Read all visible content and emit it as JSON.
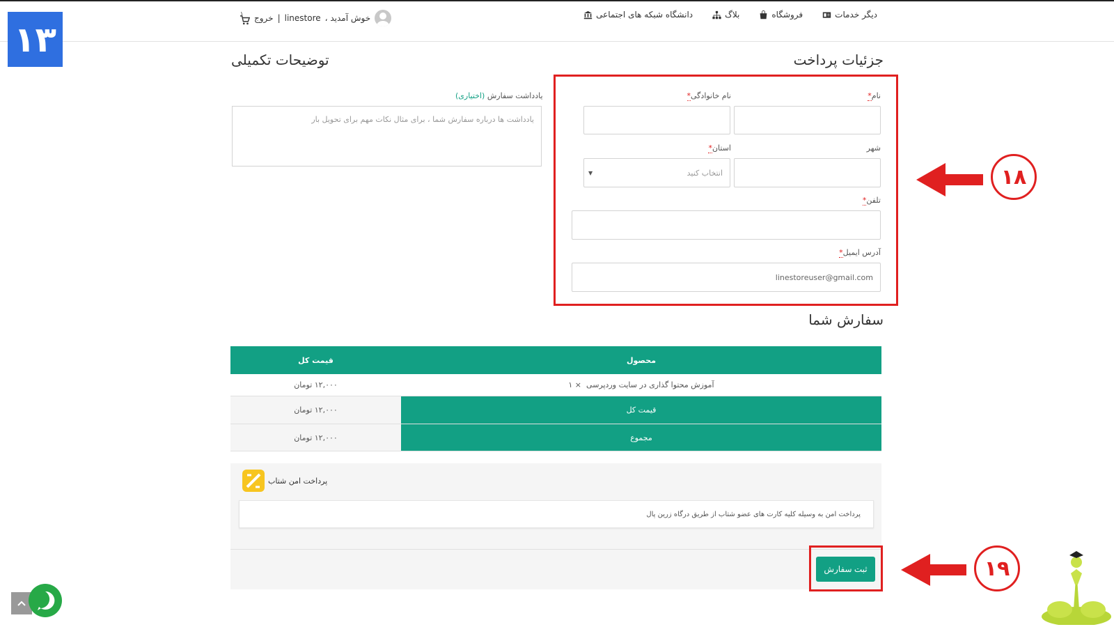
{
  "corner_badge": "۱۳",
  "nav": {
    "items": [
      {
        "label": "دانشگاه شبکه های اجتماعی",
        "icon": "bank-icon"
      },
      {
        "label": "بلاگ",
        "icon": "sitemap-icon"
      },
      {
        "label": "فروشگاه",
        "icon": "shopping-bag-icon"
      },
      {
        "label": "دیگر خدمات",
        "icon": "id-card-icon"
      }
    ]
  },
  "user": {
    "welcome": "خوش آمدید ،",
    "username": "linestore",
    "separator": "|",
    "logout": "خروج",
    "cart_count": "۱"
  },
  "billing": {
    "title": "جزئیات پرداخت",
    "first_name_label": "نام",
    "last_name_label": "نام خانوادگی",
    "city_label": "شهر",
    "province_label": "استان",
    "province_placeholder": "انتخاب کنید",
    "phone_label": "تلفن",
    "email_label": "آدرس ایمیل",
    "email_value": "linestoreuser@gmail.com",
    "required_mark": "*"
  },
  "notes": {
    "title": "توضیحات تکمیلی",
    "label": "یادداشت سفارش",
    "optional": "(اختیاری)",
    "placeholder": "یادداشت ها درباره سفارش شما ، برای مثال نکات مهم برای تحویل بار"
  },
  "order": {
    "title": "سفارش شما",
    "col_product": "محصول",
    "col_total": "قیمت کل",
    "item_name": "آموزش محتوا گذاری در سایت وردپرسی",
    "item_qty": "× ۱",
    "item_price": "۱۲,۰۰۰ تومان",
    "subtotal_label": "قیمت کل",
    "subtotal_value": "۱۲,۰۰۰ تومان",
    "total_label": "مجموع",
    "total_value": "۱۲,۰۰۰ تومان"
  },
  "payment": {
    "method": "پرداخت امن شتاب",
    "description": "پرداخت امن به وسیله کلیه کارت های عضو شتاب از طریق درگاه زرین پال",
    "submit": "ثبت سفارش"
  },
  "annotations": {
    "step_a": "۱۸",
    "step_b": "۱۹"
  },
  "colors": {
    "accent": "#12a084",
    "highlight": "#e02020",
    "badge": "#2f6fe0"
  }
}
